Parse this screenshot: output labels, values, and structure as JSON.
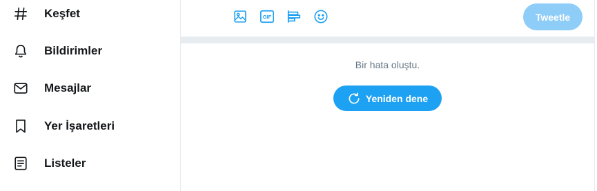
{
  "sidebar": {
    "items": [
      {
        "label": "Keşfet",
        "icon": "hashtag-icon"
      },
      {
        "label": "Bildirimler",
        "icon": "bell-icon"
      },
      {
        "label": "Mesajlar",
        "icon": "envelope-icon"
      },
      {
        "label": "Yer İşaretleri",
        "icon": "bookmark-icon"
      },
      {
        "label": "Listeler",
        "icon": "list-icon"
      }
    ]
  },
  "composer": {
    "tools": [
      "image-icon",
      "gif-icon",
      "poll-icon",
      "emoji-icon"
    ],
    "gif_text": "GIF",
    "tweet_button": "Tweetle"
  },
  "error": {
    "message": "Bir hata oluştu.",
    "retry_label": "Yeniden dene"
  },
  "colors": {
    "accent": "#1da1f2",
    "accent_disabled": "#8ecdf8",
    "text": "#14171a",
    "muted": "#657786",
    "border": "#e6ecf0"
  }
}
